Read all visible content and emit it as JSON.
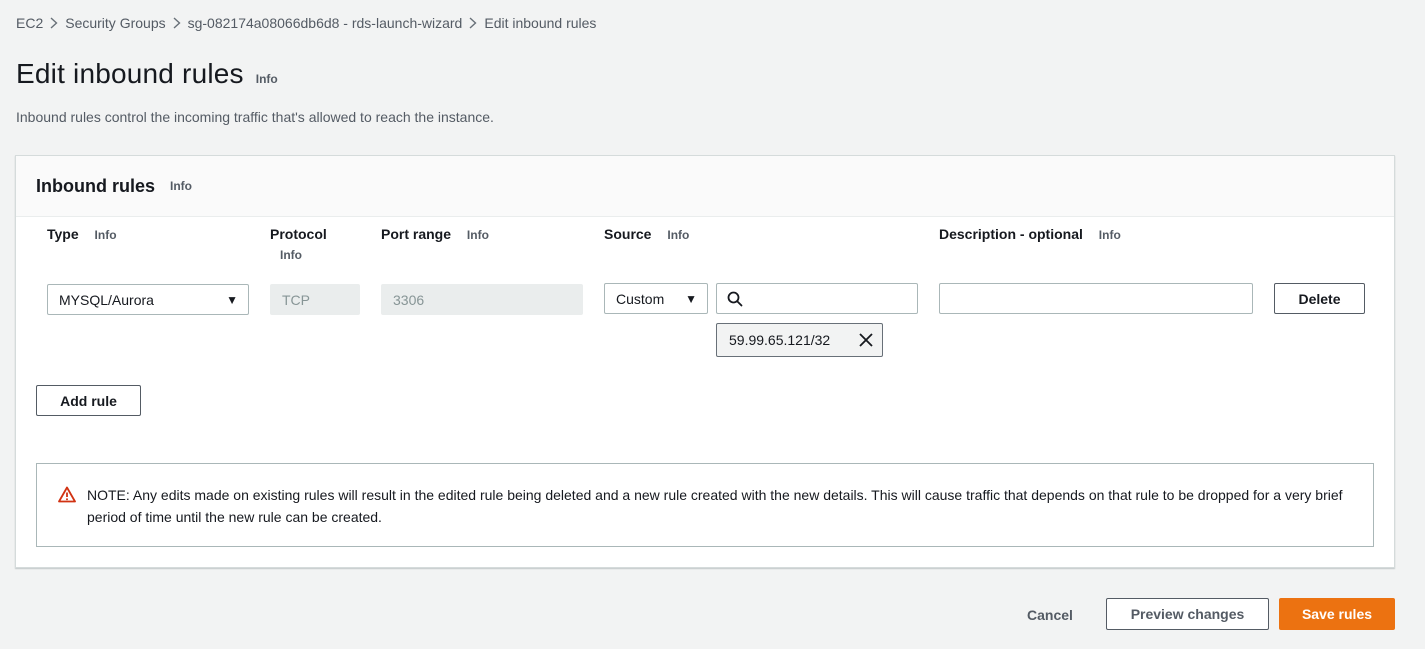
{
  "breadcrumb": {
    "items": [
      "EC2",
      "Security Groups",
      "sg-082174a08066db6d8 - rds-launch-wizard",
      "Edit inbound rules"
    ]
  },
  "header": {
    "title": "Edit inbound rules",
    "info": "Info",
    "description": "Inbound rules control the incoming traffic that's allowed to reach the instance."
  },
  "panel": {
    "title": "Inbound rules",
    "info": "Info",
    "columns": {
      "type": "Type",
      "protocol": "Protocol",
      "port_range": "Port range",
      "source": "Source",
      "description": "Description - optional",
      "info": "Info"
    },
    "rule": {
      "type_value": "MYSQL/Aurora",
      "protocol_value": "TCP",
      "port_value": "3306",
      "source_type": "Custom",
      "source_search_value": "",
      "source_token": "59.99.65.121/32",
      "description_value": "",
      "delete_label": "Delete"
    },
    "add_rule_label": "Add rule",
    "warning_text": "NOTE: Any edits made on existing rules will result in the edited rule being deleted and a new rule created with the new details. This will cause traffic that depends on that rule to be dropped for a very brief period of time until the new rule can be created."
  },
  "footer": {
    "cancel": "Cancel",
    "preview": "Preview changes",
    "save": "Save rules"
  },
  "colors": {
    "primary": "#ec7211",
    "warning_icon": "#d13212",
    "background": "#f2f3f3"
  },
  "icons": {
    "separator": "chevron-right-icon",
    "caret": "caret-down-icon",
    "search": "search-icon",
    "remove": "close-icon",
    "warning": "warning-icon"
  }
}
